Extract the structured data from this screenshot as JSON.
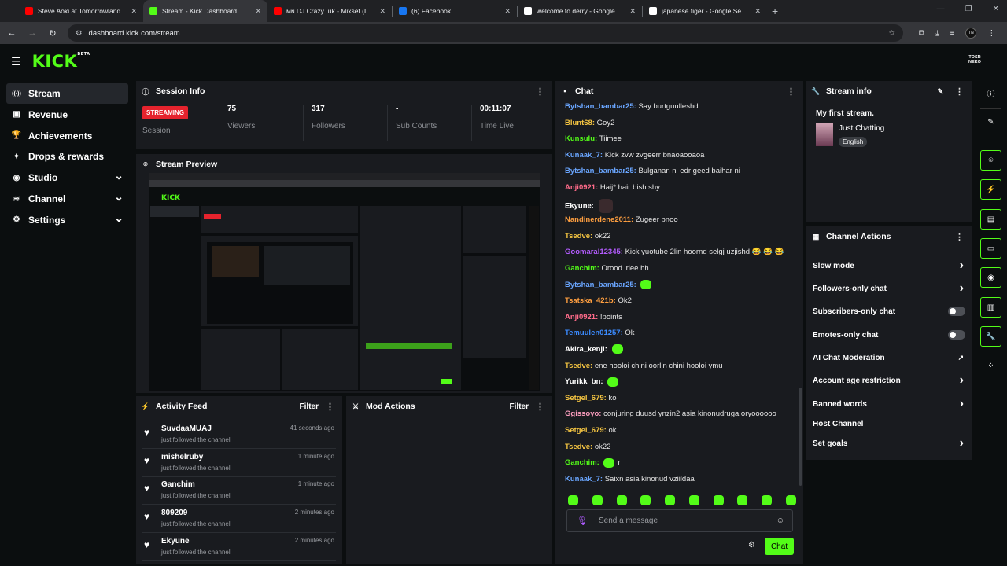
{
  "browser": {
    "tabs": [
      {
        "title": "Steve Aoki at Tomorrowland",
        "fav": "youtube-icon",
        "color": "#ff0000",
        "active": false
      },
      {
        "title": "Stream - Kick Dashboard",
        "fav": "kick-icon",
        "color": "#53fc18",
        "active": true
      },
      {
        "title": "ᴍɴ DJ CrazyTuk - Mixset (LIVE)",
        "fav": "youtube-icon",
        "color": "#ff0000",
        "active": false
      },
      {
        "title": "(6) Facebook",
        "fav": "facebook-icon",
        "color": "#1877f2",
        "active": false
      },
      {
        "title": "welcome to derry - Google Sea",
        "fav": "google-icon",
        "color": "#ffffff",
        "active": false
      },
      {
        "title": "japanese tiger - Google Search",
        "fav": "google-icon",
        "color": "#ffffff",
        "active": false
      }
    ],
    "url": "dashboard.kick.com/stream"
  },
  "header": {
    "logo": "KICK",
    "logo_sup": "BETA",
    "user_badge": "TOSR NEKO"
  },
  "sidebar": {
    "items": [
      {
        "label": "Stream",
        "icon": "stream-icon",
        "active": true,
        "chevron": false
      },
      {
        "label": "Revenue",
        "icon": "revenue-icon",
        "active": false,
        "chevron": false
      },
      {
        "label": "Achievements",
        "icon": "trophy-icon",
        "active": false,
        "chevron": false
      },
      {
        "label": "Drops & rewards",
        "icon": "gift-icon",
        "active": false,
        "chevron": false
      },
      {
        "label": "Studio",
        "icon": "studio-icon",
        "active": false,
        "chevron": true
      },
      {
        "label": "Channel",
        "icon": "channel-icon",
        "active": false,
        "chevron": true
      },
      {
        "label": "Settings",
        "icon": "settings-icon",
        "active": false,
        "chevron": true
      }
    ]
  },
  "session": {
    "title": "Session Info",
    "status": "STREAMING",
    "status_label": "Session",
    "viewers": "75",
    "viewers_label": "Viewers",
    "followers": "317",
    "followers_label": "Followers",
    "subs": "-",
    "subs_label": "Sub Counts",
    "time": "00:11:07",
    "time_label": "Time Live"
  },
  "preview": {
    "title": "Stream Preview"
  },
  "activity": {
    "title": "Activity Feed",
    "filter": "Filter",
    "items": [
      {
        "name": "SuvdaaMUAJ",
        "action": "just followed the channel",
        "time": "41 seconds ago"
      },
      {
        "name": "mishelruby",
        "action": "just followed the channel",
        "time": "1 minute ago"
      },
      {
        "name": "Ganchim",
        "action": "just followed the channel",
        "time": "1 minute ago"
      },
      {
        "name": "809209",
        "action": "just followed the channel",
        "time": "2 minutes ago"
      },
      {
        "name": "Ekyune",
        "action": "just followed the channel",
        "time": "2 minutes ago"
      }
    ]
  },
  "mod": {
    "title": "Mod Actions",
    "filter": "Filter"
  },
  "chat": {
    "title": "Chat",
    "messages": [
      {
        "user": "Bytshan_bambar25",
        "color": "#6aa6ff",
        "text": "Say burtguulleshd",
        "emote": ""
      },
      {
        "user": "Blunt68",
        "color": "#f5c542",
        "text": "Goy2",
        "emote": ""
      },
      {
        "user": "Kunsulu",
        "color": "#53fc18",
        "text": "Tiimee",
        "emote": ""
      },
      {
        "user": "Kunaak_7",
        "color": "#6aa6ff",
        "text": "Kick zvw zvgeerr bnaoaooaoa",
        "emote": ""
      },
      {
        "user": "Bytshan_bambar25",
        "color": "#6aa6ff",
        "text": "Bulganan ni edr geed baihar ni",
        "emote": ""
      },
      {
        "user": "Anji0921",
        "color": "#ff6b8a",
        "text": "Haij* hair bish shy",
        "emote": ""
      },
      {
        "user": "Ekyune",
        "color": "#ffffff",
        "text": "",
        "emote": "dark"
      },
      {
        "user": "Nandinerdene2011",
        "color": "#ff9f40",
        "text": "Zugeer bnoo",
        "emote": ""
      },
      {
        "user": "Tsedve",
        "color": "#f5c542",
        "text": "ok22",
        "emote": ""
      },
      {
        "user": "Goomaral12345",
        "color": "#b45cff",
        "text": "Kick yuotube 2lin hoornd selgj uzjishd 😂 😂 😂",
        "emote": ""
      },
      {
        "user": "Ganchim",
        "color": "#53fc18",
        "text": "Orood irlee hh",
        "emote": ""
      },
      {
        "user": "Bytshan_bambar25",
        "color": "#6aa6ff",
        "text": "",
        "emote": "green"
      },
      {
        "user": "Tsatska_421b",
        "color": "#ff9f40",
        "text": "Ok2",
        "emote": ""
      },
      {
        "user": "Anji0921",
        "color": "#ff6b8a",
        "text": "!points",
        "emote": ""
      },
      {
        "user": "Temuulen01257",
        "color": "#3b8bff",
        "text": "Ok",
        "emote": ""
      },
      {
        "user": "Akira_kenji",
        "color": "#ffffff",
        "text": "",
        "emote": "green"
      },
      {
        "user": "Tsedve",
        "color": "#f5c542",
        "text": "ene hooloi chini oorlin chini hooloi ymu",
        "emote": ""
      },
      {
        "user": "Yurikk_bn",
        "color": "#ffffff",
        "text": "",
        "emote": "green"
      },
      {
        "user": "Setgel_679",
        "color": "#f5c542",
        "text": "ko",
        "emote": ""
      },
      {
        "user": "Ggissoyo",
        "color": "#ff9fc0",
        "text": "conjuring duusd ynzin2 asia kinonudruga oryoooooo",
        "emote": ""
      },
      {
        "user": "Setgel_679",
        "color": "#f5c542",
        "text": "ok",
        "emote": ""
      },
      {
        "user": "Tsedve",
        "color": "#f5c542",
        "text": "ok22",
        "emote": ""
      },
      {
        "user": "Ganchim",
        "color": "#53fc18",
        "text": "r",
        "emote": "green"
      },
      {
        "user": "Kunaak_7",
        "color": "#6aa6ff",
        "text": "Saixn asia kinonud vziildaa",
        "emote": ""
      }
    ],
    "placeholder": "Send a message",
    "send": "Chat"
  },
  "stream_info": {
    "title": "Stream info",
    "stream_title": "My first stream.",
    "category": "Just Chatting",
    "language": "English"
  },
  "channel_actions": {
    "title": "Channel Actions",
    "items": [
      {
        "label": "Slow mode",
        "control": "chevron"
      },
      {
        "label": "Followers-only chat",
        "control": "chevron"
      },
      {
        "label": "Subscribers-only chat",
        "control": "toggle"
      },
      {
        "label": "Emotes-only chat",
        "control": "toggle"
      },
      {
        "label": "AI Chat Moderation",
        "control": "external"
      },
      {
        "label": "Account age restriction",
        "control": "chevron"
      },
      {
        "label": "Banned words",
        "control": "chevron"
      },
      {
        "label": "Host Channel",
        "control": "none"
      },
      {
        "label": "Set goals",
        "control": "chevron"
      }
    ]
  },
  "colors": {
    "accent": "#53fc18",
    "live": "#e5232d"
  }
}
